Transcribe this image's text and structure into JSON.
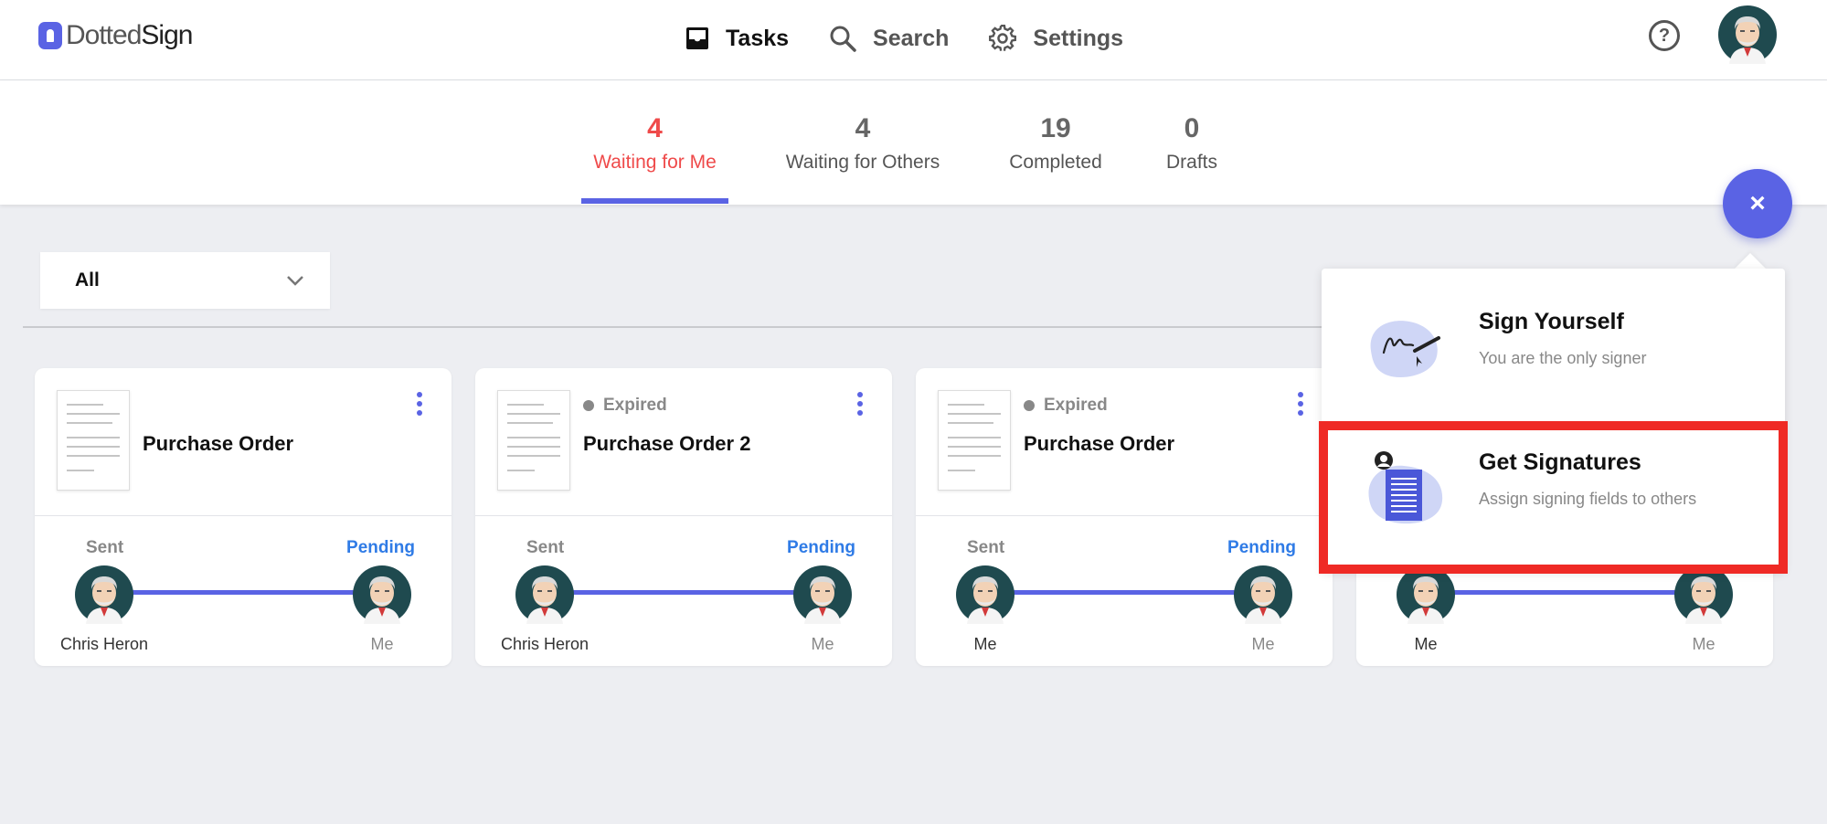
{
  "app": {
    "logo_text_light": "Dotted",
    "logo_text_bold": "Sign"
  },
  "nav": {
    "items": [
      {
        "label": "Tasks",
        "icon": "inbox-icon",
        "active": true
      },
      {
        "label": "Search",
        "icon": "search-icon",
        "active": false
      },
      {
        "label": "Settings",
        "icon": "gear-icon",
        "active": false
      }
    ],
    "help_icon_glyph": "?"
  },
  "tabs": [
    {
      "count": "4",
      "label": "Waiting for Me",
      "active": true
    },
    {
      "count": "4",
      "label": "Waiting for Others",
      "active": false
    },
    {
      "count": "19",
      "label": "Completed",
      "active": false
    },
    {
      "count": "0",
      "label": "Drafts",
      "active": false
    }
  ],
  "filter": {
    "selected": "All"
  },
  "cards": [
    {
      "status": "",
      "title": "Purchase Order",
      "sent_label": "Sent",
      "pending_label": "Pending",
      "from_name": "Chris Heron",
      "to_name": "Me"
    },
    {
      "status": "Expired",
      "title": "Purchase Order 2",
      "sent_label": "Sent",
      "pending_label": "Pending",
      "from_name": "Chris Heron",
      "to_name": "Me"
    },
    {
      "status": "Expired",
      "title": "Purchase Order",
      "sent_label": "Sent",
      "pending_label": "Pending",
      "from_name": "Me",
      "to_name": "Me"
    },
    {
      "status": "",
      "title": "",
      "sent_label": "",
      "pending_label": "",
      "from_name": "Me",
      "to_name": "Me"
    }
  ],
  "fab": {
    "glyph": "×"
  },
  "popover": {
    "options": [
      {
        "title": "Sign Yourself",
        "subtitle": "You are the only signer",
        "icon": "signature-pen-icon"
      },
      {
        "title": "Get Signatures",
        "subtitle": "Assign signing fields to others",
        "icon": "document-people-icon",
        "highlighted": true
      }
    ]
  },
  "colors": {
    "accent": "#5a63e4",
    "active_tab": "#ef4a4a",
    "pending": "#2f7be6",
    "highlight": "#ef2a25",
    "background": "#edeef2"
  }
}
